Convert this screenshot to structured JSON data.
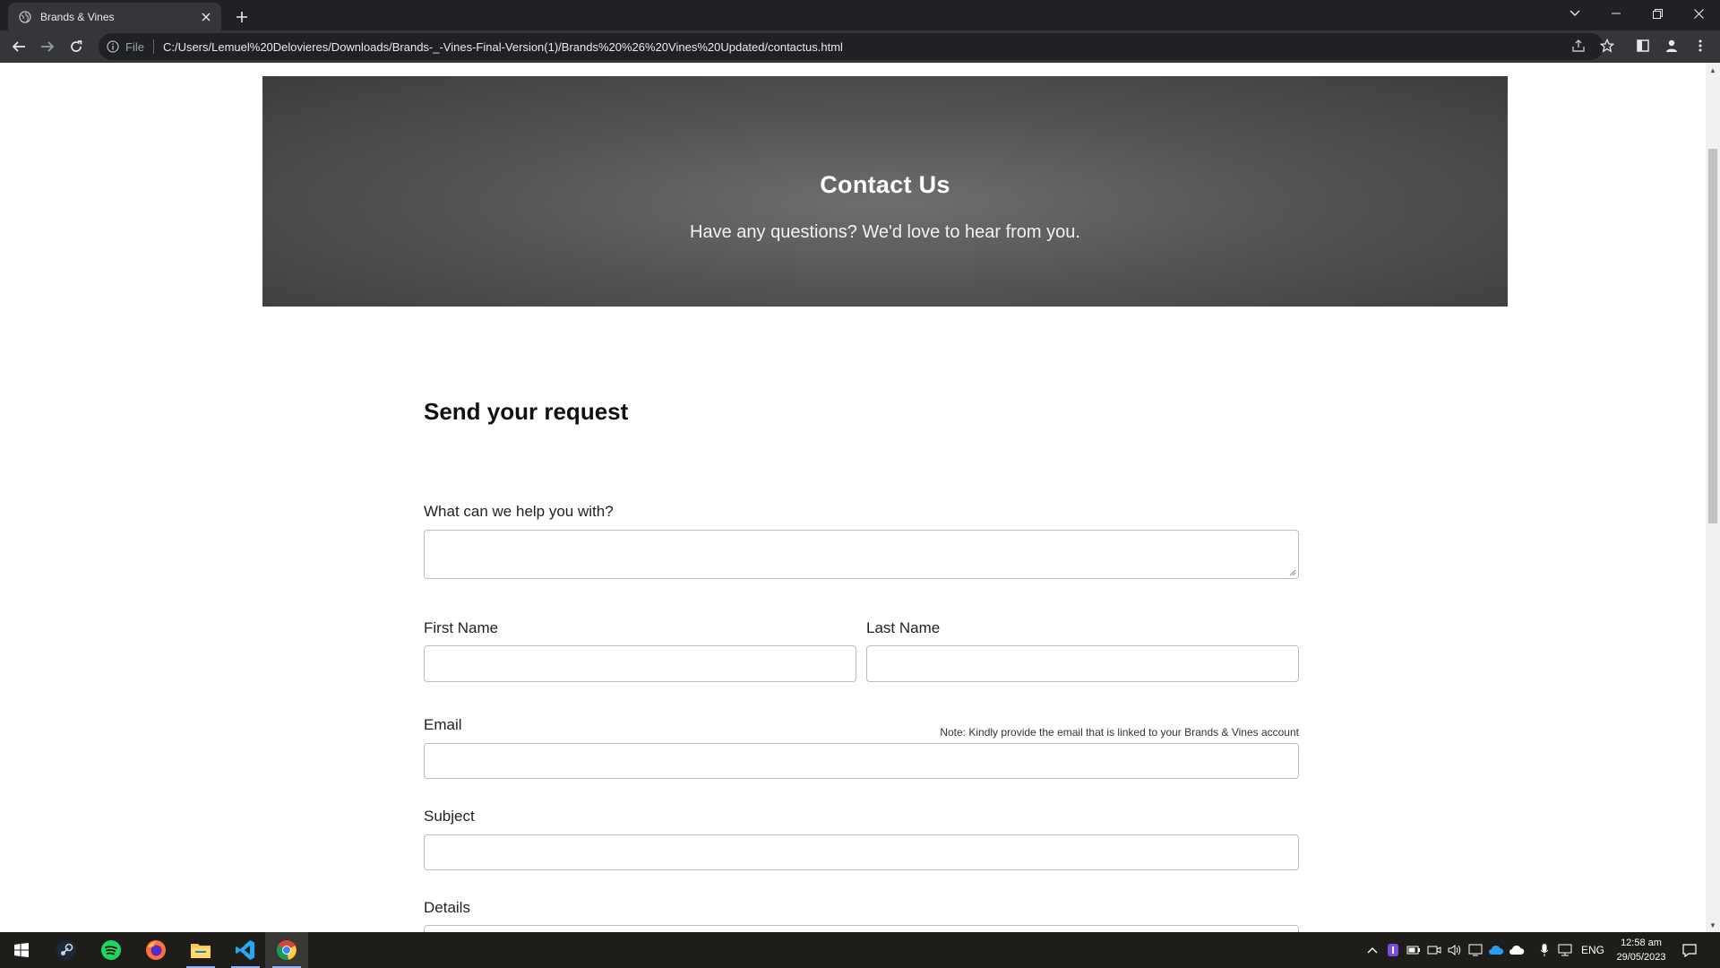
{
  "browser": {
    "tab_title": "Brands & Vines",
    "url_scheme": "File",
    "url": "C:/Users/Lemuel%20Delovieres/Downloads/Brands-_-Vines-Final-Version(1)/Brands%20%26%20Vines%20Updated/contactus.html"
  },
  "hero": {
    "title": "Contact Us",
    "subtitle": "Have any questions? We'd love to hear from you."
  },
  "form": {
    "title": "Send your request",
    "help_label": "What can we help you with?",
    "first_name_label": "First Name",
    "last_name_label": "Last Name",
    "email_label": "Email",
    "email_note": "Note: Kindly provide the email that is linked to your Brands & Vines account",
    "subject_label": "Subject",
    "details_label": "Details"
  },
  "taskbar": {
    "language": "ENG",
    "time": "12:58 am",
    "date": "29/05/2023",
    "apps": [
      "windows-start",
      "steam",
      "spotify",
      "firefox",
      "file-explorer",
      "vscode",
      "chrome"
    ]
  }
}
